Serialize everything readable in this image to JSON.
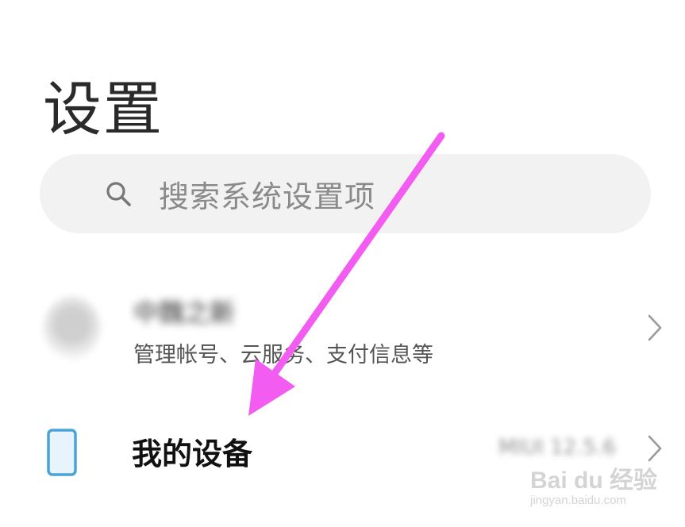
{
  "page": {
    "title": "设置"
  },
  "search": {
    "placeholder": "搜索系统设置项",
    "icon": "search-icon"
  },
  "account": {
    "name": "中魏之新",
    "subtitle": "管理帐号、云服务、支付信息等",
    "icon": "avatar"
  },
  "device": {
    "label": "我的设备",
    "version": "MIUI 12.5.6",
    "icon": "phone-icon"
  },
  "annotation": {
    "color": "#f25cf0"
  },
  "watermark": {
    "brand": "Bai du 经验",
    "url": "jingyan.baidu.com"
  },
  "colors": {
    "search_bg": "#f2f2f2",
    "device_icon": "#4aa3d8"
  }
}
